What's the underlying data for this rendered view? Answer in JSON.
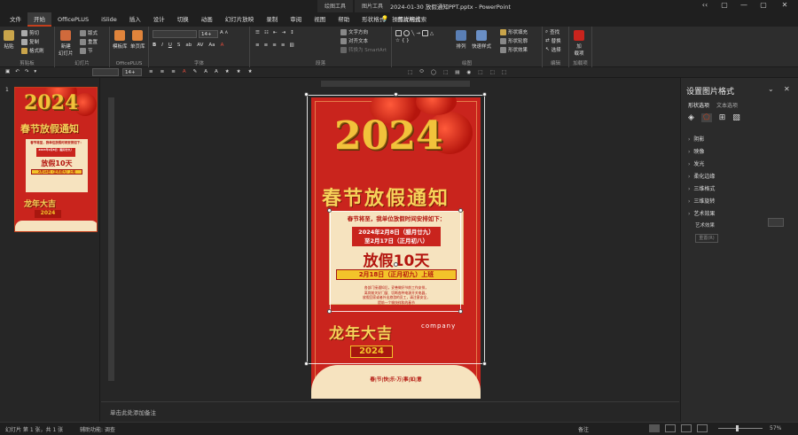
{
  "window": {
    "context_groups": [
      "绘图工具",
      "图片工具"
    ],
    "title": "2024-01-30 放假通知PPT.pptx  -  PowerPoint",
    "controls": [
      "‹‹",
      "▢",
      "—",
      "▢",
      "✕"
    ]
  },
  "tabs": [
    "文件",
    "开始",
    "OfficePLUS",
    "iSlide",
    "插入",
    "设计",
    "切换",
    "动画",
    "幻灯片放映",
    "录制",
    "审阅",
    "视图",
    "帮助",
    "形状格式",
    "图片格式"
  ],
  "active_tab": "开始",
  "search": {
    "placeholder": "操作说明搜索"
  },
  "ribbon": {
    "clipboard": {
      "paste": "粘贴",
      "cut": "剪切",
      "copy": "复制",
      "painter": "格式刷",
      "label": "剪贴板"
    },
    "slides": {
      "new_slide": "新建\n幻灯片",
      "layout": "版式",
      "reset": "重置",
      "section": "节",
      "label": "幻灯片"
    },
    "officeplus": {
      "template": "模板库",
      "single": "单页库",
      "label": "OfficePLUS"
    },
    "font": {
      "font_size": "14+",
      "label": "字体"
    },
    "paragraph": {
      "text_direction": "文字方向",
      "align_text": "对齐文本",
      "smartart": "转换为 SmartArt",
      "label": "段落"
    },
    "drawing": {
      "arrange": "排列",
      "quick_styles": "快速样式",
      "fill": "形状填充",
      "outline": "形状轮廓",
      "effects": "形状效果",
      "label": "绘图"
    },
    "editing": {
      "find": "查找",
      "replace": "替换",
      "select": "选择",
      "label": "编辑"
    },
    "addins": {
      "addin": "加\n载项",
      "label": "加载项"
    }
  },
  "qat": {
    "font_size": "14+"
  },
  "thumbnail": {
    "number": "1"
  },
  "slide": {
    "year": "2024",
    "headline": "春节放假通知",
    "intro": "春节将至，我单位放假时间安排如下：",
    "date_range_1": "2024年2月8日（腊月廿九）",
    "date_range_2": "至2月17日（正月初八）",
    "days": "放假10天",
    "return_day": "2月18日（正月初九）上班",
    "notice": "各部门接通知后，妥善做好节前工作安排，\n离岗前关好门窗、切断各种电源开关电器，\n放假回家或者外出旅游的员工，请注意安全，\n提前一个愉快祥和的春节",
    "footer_title": "龙年大吉",
    "footer_year": "2024",
    "company": "company",
    "greeting": "春|节|快|乐·万|事|如|意"
  },
  "notes": {
    "placeholder": "单击此处添加备注"
  },
  "format_pane": {
    "title": "设置图片格式",
    "tabs": [
      "形状选项",
      "文本选项"
    ],
    "sections": [
      "阴影",
      "映像",
      "发光",
      "柔化边缘",
      "三维格式",
      "三维旋转",
      "艺术效果"
    ],
    "expanded_section": "艺术效果",
    "art_effect_label": "艺术效果",
    "reset_button": "重置(R)"
  },
  "status": {
    "slide_info": "幻灯片 第 1 张，共 1 张",
    "accessibility": "辅助功能: 调查",
    "notes_btn": "备注",
    "zoom": "57%"
  },
  "colors": {
    "accent": "#c43e1c",
    "slide_red": "#c9241d",
    "gold": "#f3c32a",
    "cream": "#f6e3bf"
  }
}
